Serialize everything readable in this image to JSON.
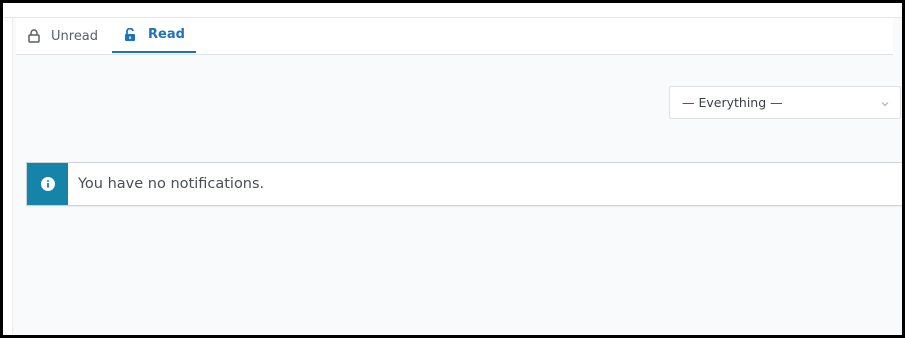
{
  "tabs": [
    {
      "label": "Unread",
      "icon": "lock-icon",
      "active": false
    },
    {
      "label": "Read",
      "icon": "unlock-icon",
      "active": true
    }
  ],
  "filter": {
    "selected": "— Everything —",
    "icon": "chevron-down-icon"
  },
  "alert": {
    "message": "You have no notifications.",
    "icon": "info-icon"
  },
  "colors": {
    "accent": "#1f72bd",
    "info": "#1683a8",
    "background": "#f9fafb"
  }
}
